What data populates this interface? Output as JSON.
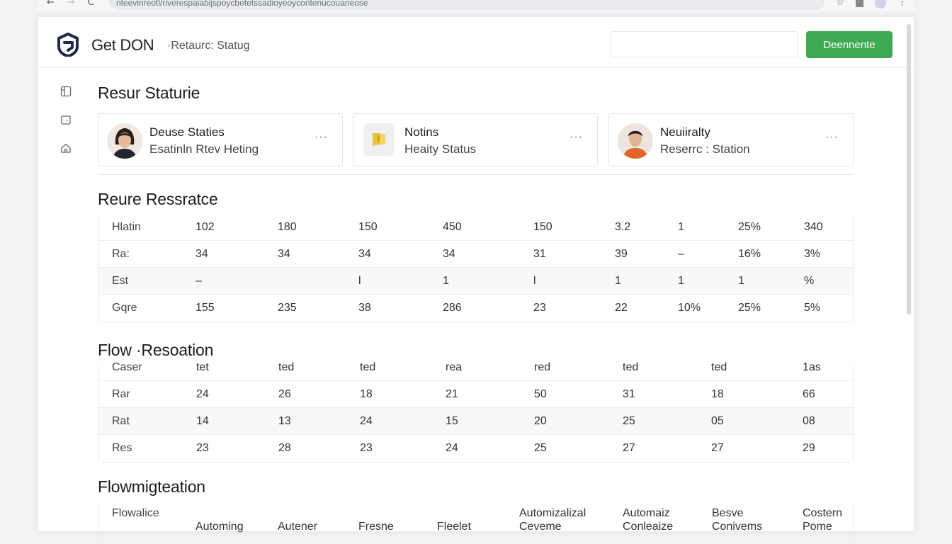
{
  "browser": {
    "url": "nteevinreotl/riverespaiabijspoycbetetssadioyeoycontenucouaneose",
    "nav_back": "←",
    "nav_forward": "→",
    "nav_reload": "C",
    "icon_star": "☆",
    "icon_menu": "⋮"
  },
  "header": {
    "title": "Get DON",
    "subtitle": "·Retaurc: Statug",
    "search_value": "",
    "button_label": "Deennente",
    "button_color": "#3daa54"
  },
  "section1": {
    "title": "Resur Staturie",
    "cards": [
      {
        "title": "Deuse Staties",
        "subtitle": "Esatinln Rtev Heting",
        "more": "···",
        "avatar": "woman-avatar"
      },
      {
        "title": "Notins",
        "subtitle": "Heaity Status",
        "more": "···",
        "avatar": "folder-icon"
      },
      {
        "title": "Neuiiralty",
        "subtitle": "Reserrc : Station",
        "more": "···",
        "avatar": "man-avatar"
      }
    ]
  },
  "section2": {
    "title": "Reure Ressratce",
    "rows": [
      [
        "Hlatin",
        "102",
        "180",
        "150",
        "450",
        "150",
        "3.2",
        "1",
        "25%",
        "340"
      ],
      [
        "Ra:",
        "34",
        "34",
        "34",
        "34",
        "31",
        "39",
        "–",
        "16%",
        "3%"
      ],
      [
        "Est",
        "–",
        "",
        "l",
        "1",
        "l",
        "1",
        "1",
        "1",
        "%"
      ],
      [
        "Gqre",
        "155",
        "235",
        "38",
        "286",
        "23",
        "22",
        "10%",
        "25%",
        "5%"
      ]
    ]
  },
  "section3": {
    "title": "Flow ·Resoation",
    "rows": [
      [
        "Caser",
        "tet",
        "ted",
        "ted",
        "rea",
        "red",
        "ted",
        "ted",
        "1as"
      ],
      [
        "Rar",
        "24",
        "26",
        "18",
        "21",
        "50",
        "31",
        "18",
        "66"
      ],
      [
        "Rat",
        "14",
        "13",
        "24",
        "15",
        "20",
        "25",
        "05",
        "08"
      ],
      [
        "Res",
        "23",
        "28",
        "23",
        "24",
        "25",
        "27",
        "27",
        "29"
      ]
    ]
  },
  "section4": {
    "title": "Flowmigteation",
    "row_label": "Flowalice",
    "columns": [
      {
        "top": "",
        "bottom": "Automing"
      },
      {
        "top": "",
        "bottom": "Autener"
      },
      {
        "top": "",
        "bottom": "Fresne"
      },
      {
        "top": "",
        "bottom": "Fleelet"
      },
      {
        "top": "Automizalizal",
        "bottom": "Ceveme"
      },
      {
        "top": "Automaiz",
        "bottom": "Conleaize"
      },
      {
        "top": "Besve",
        "bottom": "Conivems"
      },
      {
        "top": "Costern",
        "bottom": "Pome"
      }
    ]
  },
  "sidebar": {
    "icons": [
      "panel-icon",
      "calendar-icon",
      "home-icon"
    ]
  }
}
